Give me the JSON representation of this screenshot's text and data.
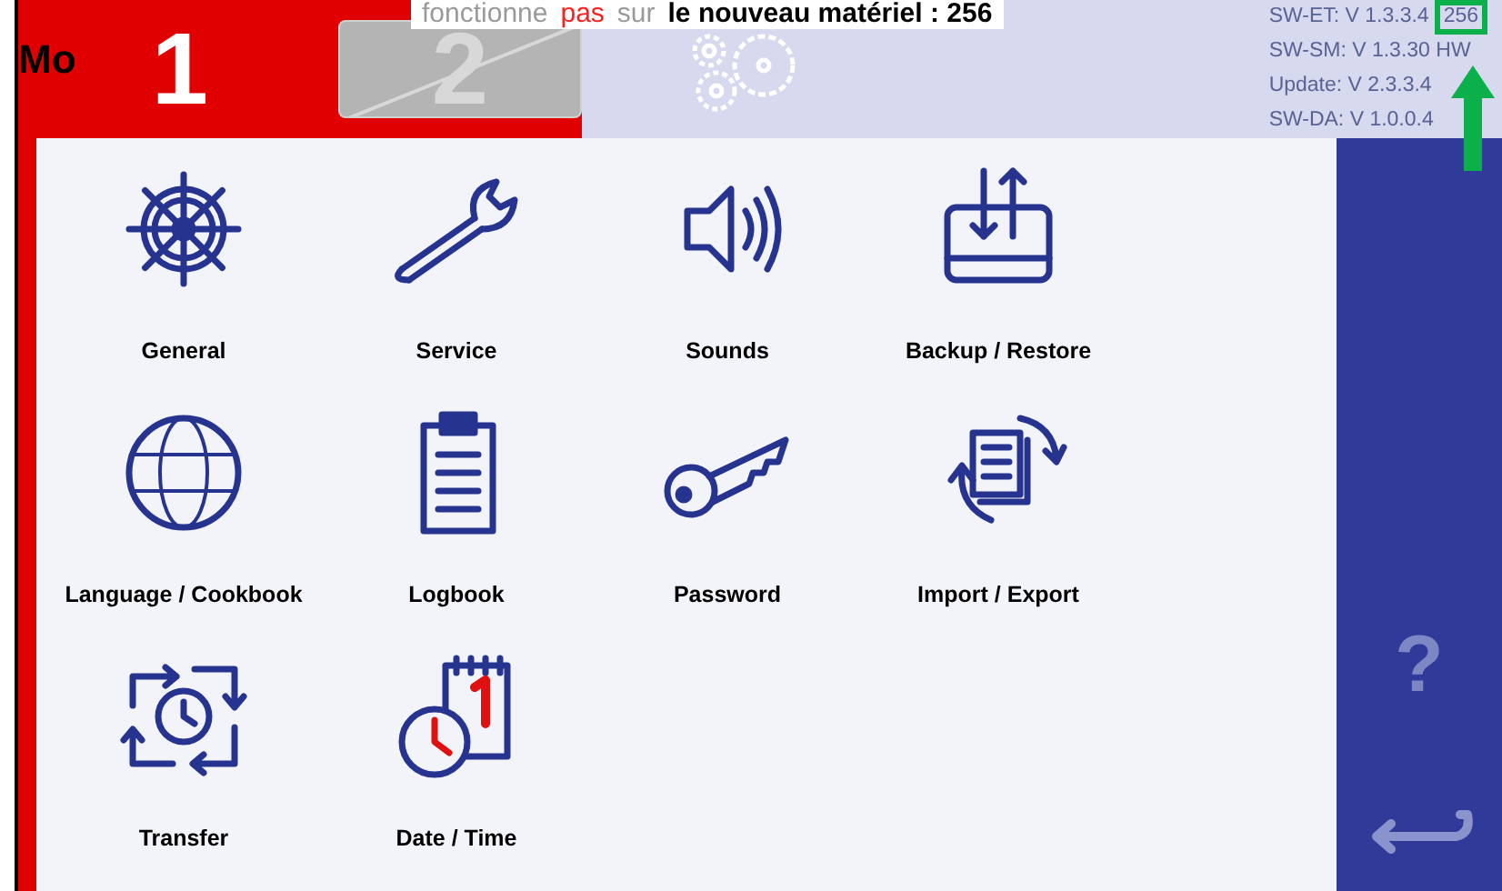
{
  "annotation": {
    "segments": [
      {
        "text": "fonctionne",
        "color": "#9a9a9a"
      },
      {
        "text": "pas",
        "color": "#ff2020"
      },
      {
        "text": "sur",
        "color": "#9a9a9a"
      },
      {
        "text": "le nouveau matériel : 256",
        "color": "#000000"
      }
    ],
    "second_line": "Mo"
  },
  "tabs": [
    {
      "label": "1",
      "selected": true,
      "disabled": false
    },
    {
      "label": "2",
      "selected": false,
      "disabled": true
    }
  ],
  "versions": [
    {
      "text": "SW-ET: V 1.3.3.4",
      "note": "256"
    },
    {
      "text": "SW-SM: V 1.3.30 HW"
    },
    {
      "text": "Update: V 2.3.3.4"
    },
    {
      "text": "SW-DA: V 1.0.0.4"
    }
  ],
  "menu": [
    {
      "kind": "wheel",
      "label": "General"
    },
    {
      "kind": "wrench",
      "label": "Service"
    },
    {
      "kind": "speaker",
      "label": "Sounds"
    },
    {
      "kind": "backup",
      "label": "Backup / Restore"
    },
    {
      "kind": "globe",
      "label": "Language / Cookbook"
    },
    {
      "kind": "clipboard",
      "label": "Logbook"
    },
    {
      "kind": "key",
      "label": "Password"
    },
    {
      "kind": "import",
      "label": "Import / Export"
    },
    {
      "kind": "transfer",
      "label": "Transfer"
    },
    {
      "kind": "calendar",
      "label": "Date / Time"
    }
  ],
  "sidebar": {
    "help": "?"
  }
}
